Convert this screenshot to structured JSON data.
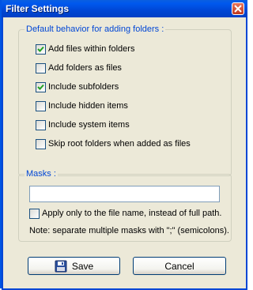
{
  "window": {
    "title": "Filter Settings"
  },
  "default_group": {
    "legend": "Default behavior for adding folders :",
    "options": [
      {
        "label": "Add files within folders",
        "checked": true
      },
      {
        "label": "Add folders as files",
        "checked": false
      },
      {
        "label": "Include subfolders",
        "checked": true
      },
      {
        "label": "Include hidden items",
        "checked": false
      },
      {
        "label": "Include system items",
        "checked": false
      },
      {
        "label": "Skip root folders when added as files",
        "checked": false
      }
    ]
  },
  "masks_group": {
    "legend": "Masks :",
    "input_value": "",
    "apply_only_label": "Apply only to the file name, instead of full path.",
    "apply_only_checked": false,
    "note": "Note: separate multiple masks with \";\" (semicolons)."
  },
  "buttons": {
    "save_label": "Save",
    "cancel_label": "Cancel"
  },
  "icons": {
    "close": "close-icon",
    "save": "floppy-disk-icon",
    "check": "checkmark-icon"
  },
  "colors": {
    "title_bar": "#0054e3",
    "legend_text": "#0046d5",
    "window_bg": "#ece9d8",
    "check_mark": "#21a121"
  }
}
